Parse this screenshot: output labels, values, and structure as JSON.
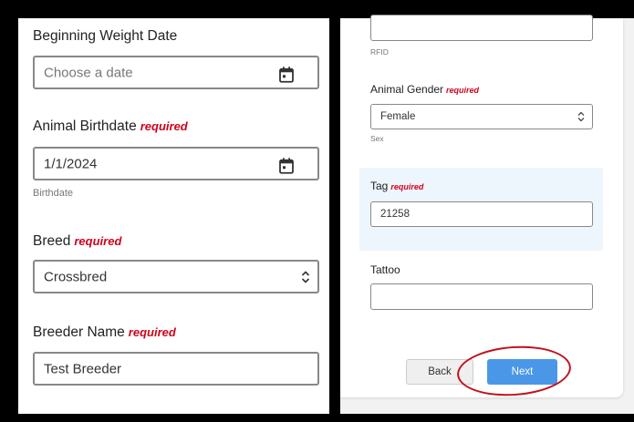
{
  "left": {
    "beginning_weight_date": {
      "label": "Beginning Weight Date",
      "placeholder": "Choose a date"
    },
    "animal_birthdate": {
      "label": "Animal Birthdate",
      "required": "required",
      "value": "1/1/2024",
      "help": "Birthdate"
    },
    "breed": {
      "label": "Breed",
      "required": "required",
      "value": "Crossbred"
    },
    "breeder_name": {
      "label": "Breeder Name",
      "required": "required",
      "value": "Test Breeder"
    }
  },
  "right": {
    "rfid": {
      "help": "RFID"
    },
    "animal_gender": {
      "label": "Animal Gender",
      "required": "required",
      "value": "Female",
      "help": "Sex"
    },
    "tag": {
      "label": "Tag",
      "required": "required",
      "value": "21258"
    },
    "tattoo": {
      "label": "Tattoo",
      "value": ""
    },
    "buttons": {
      "back": "Back",
      "next": "Next"
    }
  },
  "colors": {
    "required": "#d0021b",
    "primary": "#4a97e8",
    "highlight_circle": "#c0121b",
    "tag_bg": "#eef6fd"
  },
  "icons": [
    "calendar-icon",
    "select-arrows-icon"
  ]
}
